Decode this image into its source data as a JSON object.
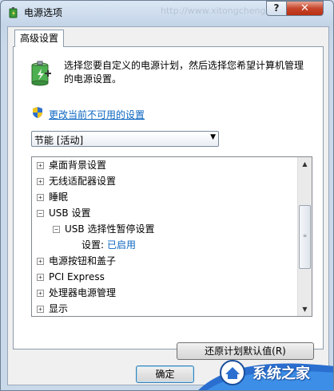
{
  "window": {
    "title": "电源选项",
    "watermark": "http://www.xitongcheng.com",
    "help_label": "?",
    "close_label": "✕"
  },
  "tab": {
    "label": "高级设置"
  },
  "panel": {
    "description": "选择您要自定义的电源计划，然后选择您希望计算机管理的电源设置。",
    "link_text": "更改当前不可用的设置"
  },
  "plan_select": {
    "value": "节能 [活动]"
  },
  "tree": {
    "items": [
      {
        "label": "桌面背景设置",
        "expander": "+"
      },
      {
        "label": "无线适配器设置",
        "expander": "+"
      },
      {
        "label": "睡眠",
        "expander": "+"
      },
      {
        "label": "USB 设置",
        "expander": "−"
      },
      {
        "label": "USB 选择性暂停设置",
        "expander": "−"
      },
      {
        "label": "设置:",
        "value": "已启用"
      },
      {
        "label": "电源按钮和盖子",
        "expander": "+"
      },
      {
        "label": "PCI Express",
        "expander": "+"
      },
      {
        "label": "处理器电源管理",
        "expander": "+"
      },
      {
        "label": "显示",
        "expander": "+"
      }
    ]
  },
  "buttons": {
    "restore_defaults": "还原计划默认值(R)",
    "ok": "确定"
  },
  "logo": {
    "text": "系统之家"
  },
  "colors": {
    "link": "#0b66c0",
    "close_red": "#c6462b"
  }
}
